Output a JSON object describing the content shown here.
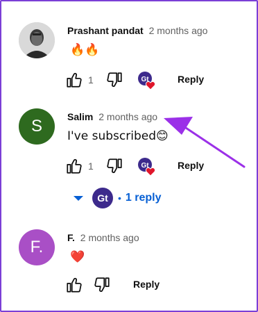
{
  "colors": {
    "accent_purple": "#7b3fd6",
    "link_blue": "#065fd4",
    "avatar_green": "#2e6a1f",
    "avatar_purple": "#a94fc6"
  },
  "comments": [
    {
      "author": "Prashant pandat",
      "time": "2 months ago",
      "text": "🔥🔥",
      "likes": "1",
      "reply_label": "Reply",
      "avatar_icon": "person-photo-icon"
    },
    {
      "author": "Salim",
      "time": "2 months ago",
      "text": "I've subscribed😊",
      "likes": "1",
      "reply_label": "Reply",
      "avatar_letter": "S",
      "replies_label": "1 reply",
      "replies_separator": "•"
    },
    {
      "author": "F.",
      "time": "2 months ago",
      "text": "❤️",
      "reply_label": "Reply",
      "avatar_letter": "F."
    }
  ],
  "creator_badge": {
    "initials": "Gt"
  }
}
